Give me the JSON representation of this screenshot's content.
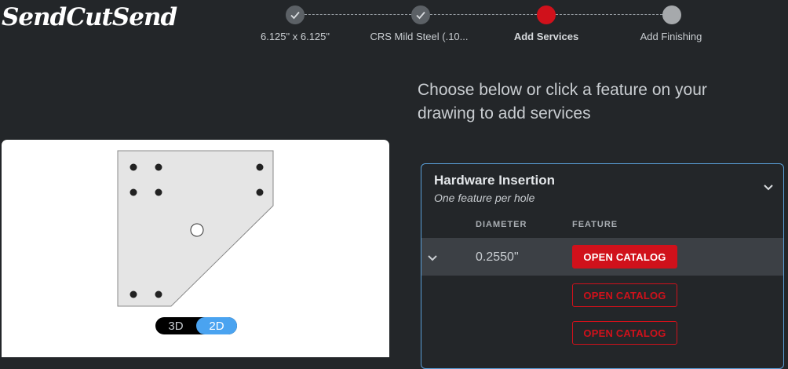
{
  "brand": {
    "logo_text": "SendCutSend"
  },
  "stepper": {
    "steps": [
      {
        "label": "6.125\" x 6.125\"",
        "state": "done",
        "icon": "check-icon"
      },
      {
        "label": "CRS Mild Steel (.10...",
        "state": "done",
        "icon": "check-icon"
      },
      {
        "label": "Add Services",
        "state": "active",
        "icon": ""
      },
      {
        "label": "Add Finishing",
        "state": "todo",
        "icon": ""
      }
    ]
  },
  "headline": "Choose below or click a feature on your drawing to add services",
  "viewer": {
    "toggle": {
      "option_3d": "3D",
      "option_2d": "2D",
      "selected": "2D"
    }
  },
  "hardware": {
    "title": "Hardware Insertion",
    "subtitle": "One feature per hole",
    "columns": {
      "diameter": "DIAMETER",
      "feature": "FEATURE"
    },
    "rows": [
      {
        "diameter": "0.2550\"",
        "button": "OPEN CATALOG",
        "style": "filled"
      },
      {
        "diameter": "",
        "button": "OPEN CATALOG",
        "style": "outline"
      },
      {
        "diameter": "",
        "button": "OPEN CATALOG",
        "style": "outline"
      }
    ]
  },
  "colors": {
    "background": "#232629",
    "accent_red": "#d0111b",
    "panel_border": "#5a9fd8",
    "toggle_selected": "#4aa3f0"
  }
}
